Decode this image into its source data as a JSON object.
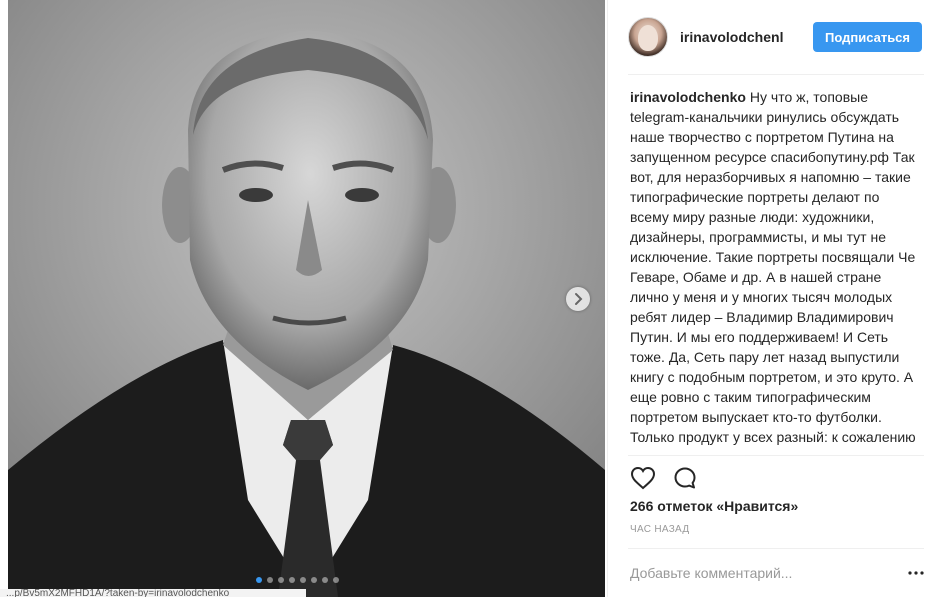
{
  "post": {
    "slide_count": 8,
    "active_slide": 1,
    "url_fragment": "...p/Bv5mX2MFHD1A/?taken-by=irinavolodchenko"
  },
  "header": {
    "username": "irinavolodchenl",
    "follow_label": "Подписаться"
  },
  "caption": {
    "author": "irinavolodchenko",
    "text": "Ну что ж, топовые telegram-канальчики ринулись обсуждать наше творчество с портретом Путина на запущенном ресурсе спасибопутину.рф Так вот, для неразборчивых я напомню – такие типографические портреты делают по всему миру разные люди: художники, дизайнеры, программисты, и мы тут не исключение. Такие портреты посвящали Че Геваре, Обаме и др. А в нашей стране лично у меня и у многих тысяч молодых ребят лидер – Владимир Владимирович Путин. И мы его поддерживаем! И Сеть тоже. Да, Сеть пару лет назад выпустили книгу с подобным портретом, и это круто. А еще ровно с таким типографическим портретом выпускает кто-то футболки. Только продукт у всех разный: к сожалению"
  },
  "stats": {
    "likes": "266 отметок «Нравится»",
    "time": "ЧАС НАЗАД"
  },
  "comment": {
    "placeholder": "Добавьте комментарий..."
  },
  "icons": {
    "next": "chevron-right-icon",
    "like": "heart-icon",
    "comment": "speech-bubble-icon",
    "more": "more-dots-icon"
  },
  "colors": {
    "accent": "#3897f0",
    "text": "#262626",
    "muted": "#999999",
    "divider": "#efefef"
  }
}
